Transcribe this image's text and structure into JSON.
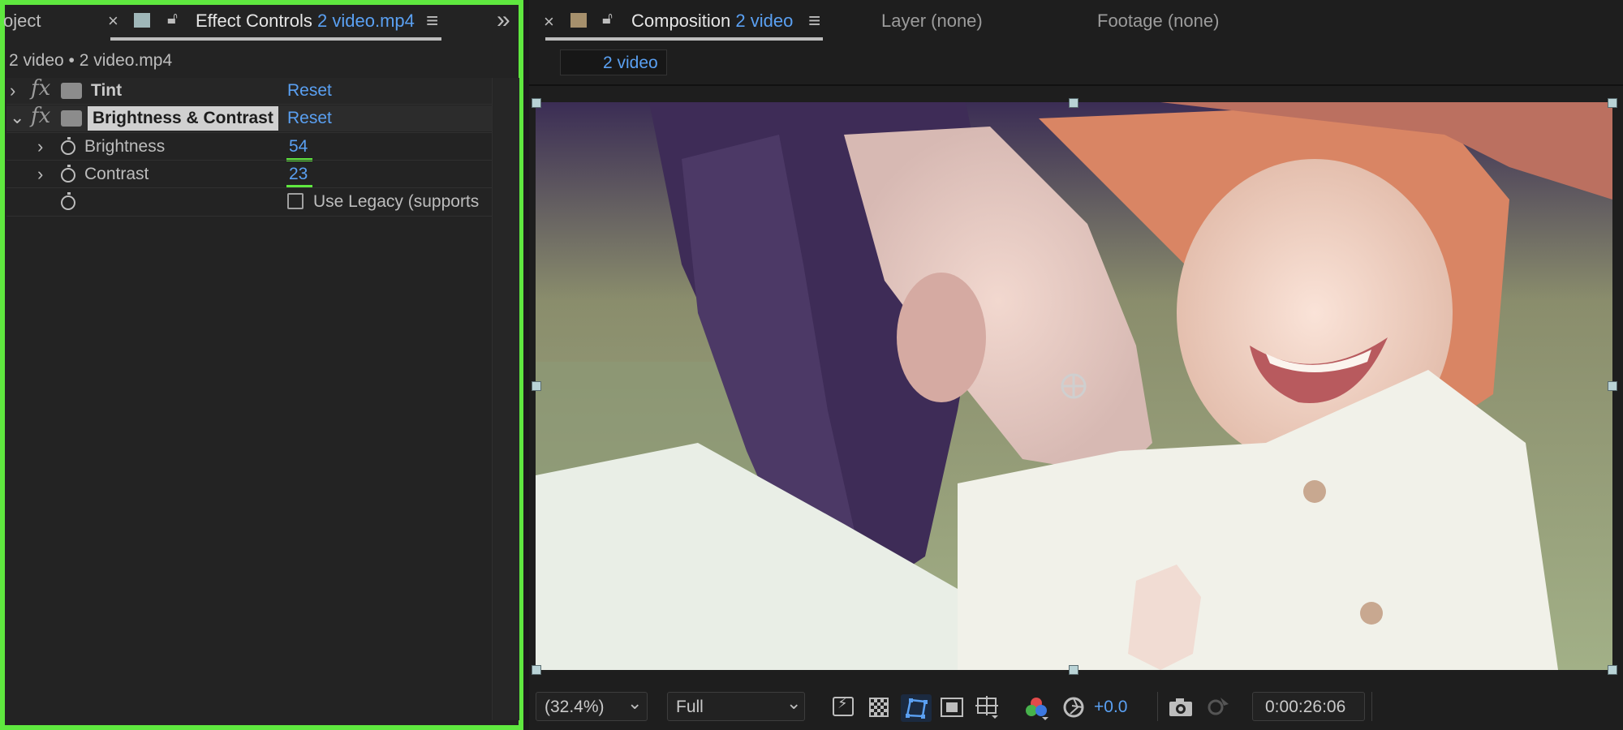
{
  "effect_controls": {
    "project_tab_fragment": "oject",
    "close_glyph": "×",
    "tab_title": "Effect Controls",
    "tab_file": "2 video.mp4",
    "menu_glyph": "≡",
    "expand_glyph": "»",
    "path_label": "2 video • 2 video.mp4",
    "effects": [
      {
        "name": "Tint",
        "reset": "Reset",
        "expanded": false
      },
      {
        "name": "Brightness & Contrast",
        "reset": "Reset",
        "expanded": true,
        "properties": [
          {
            "name": "Brightness",
            "value": "54"
          },
          {
            "name": "Contrast",
            "value": "23"
          }
        ],
        "checkbox_label": "Use Legacy (supports",
        "checkbox_checked": false
      }
    ],
    "fx_symbol": "fx",
    "collapsed_glyph": "›",
    "expanded_glyph": "⌄"
  },
  "composition": {
    "close_glyph": "×",
    "tab_title": "Composition",
    "tab_name": "2 video",
    "menu_glyph": "≡",
    "layer_tab": "Layer (none)",
    "footage_tab": "Footage (none)",
    "sub_tab": "2 video"
  },
  "viewer_toolbar": {
    "zoom": "(32.4%)",
    "resolution": "Full",
    "exposure": "+0.0",
    "timecode": "0:00:26:06",
    "chevron": "⌄"
  },
  "colors": {
    "highlight_green": "#5fe83f",
    "accent_blue": "#5aa0f2",
    "panel_bg": "#232323"
  }
}
